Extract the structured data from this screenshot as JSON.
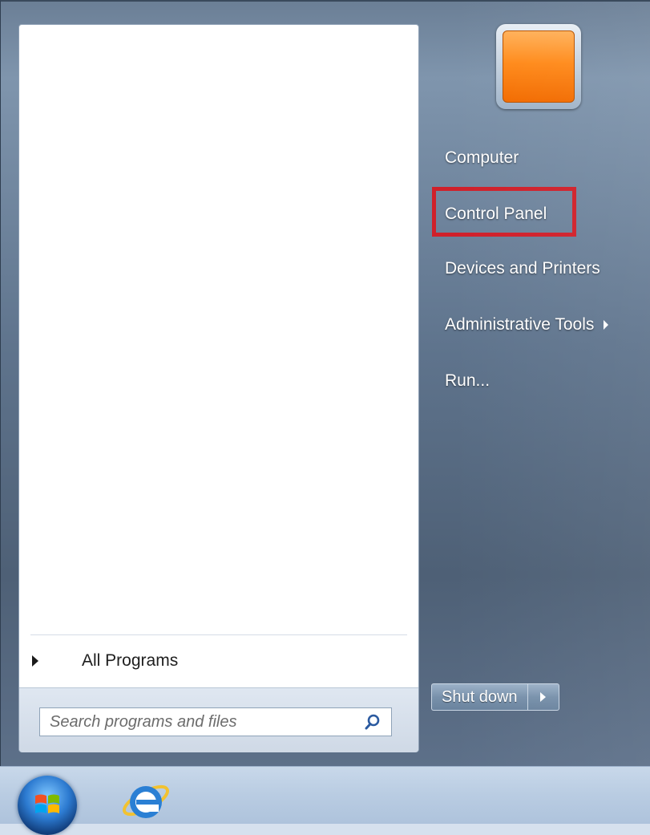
{
  "left_pane": {
    "all_programs_label": "All Programs",
    "search": {
      "placeholder": "Search programs and files",
      "value": ""
    }
  },
  "right_pane": {
    "links": [
      {
        "label": "Computer",
        "has_submenu": false
      },
      {
        "label": "Control Panel",
        "has_submenu": false,
        "highlighted": true
      },
      {
        "label": "Devices and Printers",
        "has_submenu": false
      },
      {
        "label": "Administrative Tools",
        "has_submenu": true
      },
      {
        "label": "Run...",
        "has_submenu": false
      }
    ],
    "highlight_color": "#d0202a",
    "shutdown_label": "Shut down"
  },
  "user_picture": {
    "icon": "user-picture-orange",
    "color": "#ff8a1a"
  },
  "taskbar": {
    "items": [
      {
        "icon": "start-orb-icon"
      },
      {
        "icon": "internet-explorer-icon"
      }
    ]
  }
}
